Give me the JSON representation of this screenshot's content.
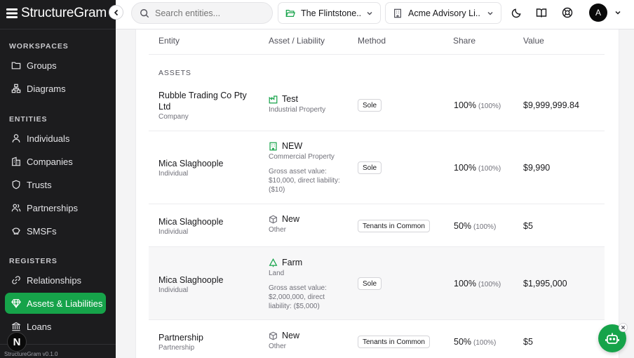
{
  "brand": {
    "name": "StructureGram",
    "version": "StructureGram v0.1.0",
    "user_initial": "N"
  },
  "sidebar": {
    "sections": [
      {
        "label": "WORKSPACES",
        "items": [
          {
            "label": "Groups",
            "icon": "folder-icon"
          },
          {
            "label": "Diagrams",
            "icon": "diagram-icon"
          }
        ]
      },
      {
        "label": "ENTITIES",
        "items": [
          {
            "label": "Individuals",
            "icon": "user-icon"
          },
          {
            "label": "Companies",
            "icon": "building-icon"
          },
          {
            "label": "Trusts",
            "icon": "shield-icon"
          },
          {
            "label": "Partnerships",
            "icon": "users-icon"
          },
          {
            "label": "SMSFs",
            "icon": "piggy-bank-icon"
          }
        ]
      },
      {
        "label": "REGISTERS",
        "items": [
          {
            "label": "Relationships",
            "icon": "link-icon"
          },
          {
            "label": "Assets & Liabilities",
            "icon": "gem-icon",
            "active": true
          },
          {
            "label": "Loans",
            "icon": "landmark-icon"
          }
        ]
      }
    ]
  },
  "header": {
    "search_placeholder": "Search entities...",
    "group_select": "The Flintstone...",
    "firm_select": "Acme Advisory Li...",
    "user_initial": "A"
  },
  "table": {
    "columns": [
      "Entity",
      "Asset / Liability",
      "Method",
      "Share",
      "Value"
    ],
    "section_label": "ASSETS",
    "rows": [
      {
        "entity": "Rubble Trading Co Pty Ltd",
        "entity_type": "Company",
        "asset": "Test",
        "asset_type": "Industrial Property",
        "note": "",
        "method": "Sole",
        "share": "100%",
        "share_sub": "(100%)",
        "value": "$9,999,999.84",
        "icon": "factory-icon"
      },
      {
        "entity": "Mica Slaghoople",
        "entity_type": "Individual",
        "asset": "NEW",
        "asset_type": "Commercial Property",
        "note": "Gross asset value: $10,000, direct liability: ($10)",
        "method": "Sole",
        "share": "100%",
        "share_sub": "(100%)",
        "value": "$9,990",
        "icon": "office-building-icon"
      },
      {
        "entity": "Mica Slaghoople",
        "entity_type": "Individual",
        "asset": "New",
        "asset_type": "Other",
        "note": "",
        "method": "Tenants in Common",
        "share": "50%",
        "share_sub": "(100%)",
        "value": "$5",
        "icon": "box-icon"
      },
      {
        "entity": "Mica Slaghoople",
        "entity_type": "Individual",
        "asset": "Farm",
        "asset_type": "Land",
        "note": "Gross asset value: $2,000,000, direct liability: ($5,000)",
        "method": "Sole",
        "share": "100%",
        "share_sub": "(100%)",
        "value": "$1,995,000",
        "icon": "tree-icon"
      },
      {
        "entity": "Partnership",
        "entity_type": "Partnership",
        "asset": "New",
        "asset_type": "Other",
        "note": "",
        "method": "Tenants in Common",
        "share": "50%",
        "share_sub": "(100%)",
        "value": "$5",
        "icon": "box-icon"
      }
    ]
  },
  "colors": {
    "accent": "#16a34a",
    "sidebar_bg": "#1c1c1e"
  }
}
